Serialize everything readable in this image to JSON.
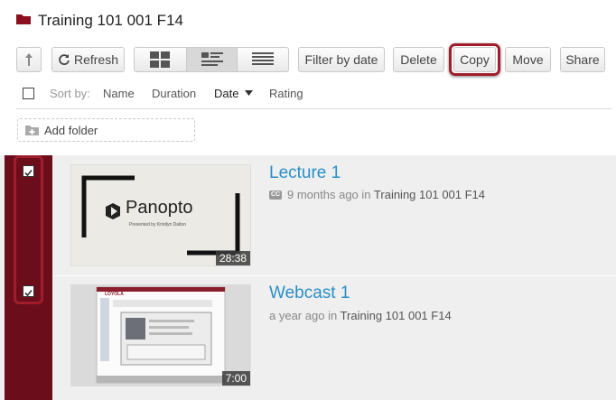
{
  "header": {
    "title": "Training 101 001 F14",
    "folder_icon": "folder-icon"
  },
  "toolbar": {
    "up_icon": "up-arrow-icon",
    "refresh_label": "Refresh",
    "filter_label": "Filter by date",
    "delete_label": "Delete",
    "copy_label": "Copy",
    "move_label": "Move",
    "share_label": "Share",
    "views": [
      "thumbnail-view",
      "detail-view",
      "list-view"
    ],
    "active_view": "detail-view"
  },
  "sort": {
    "prefix": "Sort by:",
    "options": [
      "Name",
      "Duration",
      "Date",
      "Rating"
    ],
    "active": "Date",
    "direction": "descending"
  },
  "add_folder": {
    "label": "Add folder"
  },
  "items": [
    {
      "title": "Lecture 1",
      "has_captions": true,
      "age": "9 months ago",
      "in_label": "in",
      "folder": "Training 101 001 F14",
      "duration": "28:38",
      "checked": true,
      "thumb": {
        "brand": "Panopto",
        "caption": "Presented by Kristlyn Dalton"
      }
    },
    {
      "title": "Webcast 1",
      "has_captions": false,
      "age": "a year ago",
      "in_label": "in",
      "folder": "Training 101 001 F14",
      "duration": "7:00",
      "checked": true,
      "thumb": {
        "brand": "LOYOLA"
      }
    }
  ],
  "colors": {
    "selection_bar": "#6b0d1b",
    "highlight_ring": "#a01e2c",
    "link": "#2a8fc6",
    "list_bg": "#efefef"
  }
}
